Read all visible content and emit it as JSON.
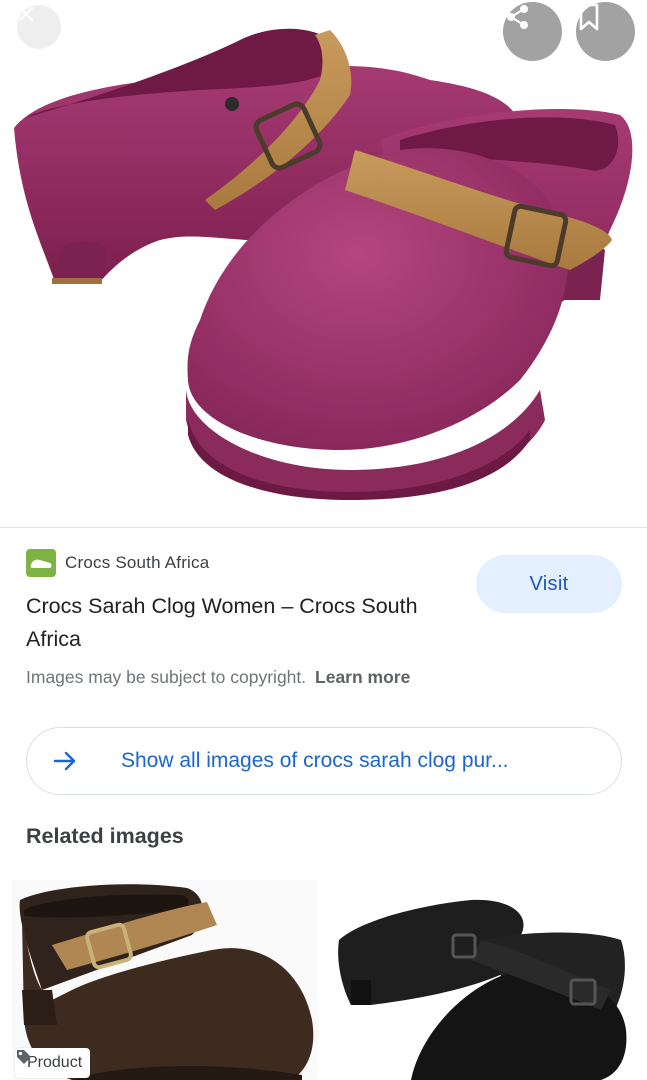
{
  "viewer": {
    "close_icon": "close-icon",
    "share_icon": "share-icon",
    "save_icon": "bookmark-icon",
    "image_subject": "crocs-sarah-clog-plum"
  },
  "result": {
    "source_name": "Crocs South Africa",
    "favicon_icon": "shoe-icon",
    "favicon_color": "#7cb342",
    "title": "Crocs Sarah Clog Women – Crocs South Africa",
    "visit_label": "Visit",
    "copyright_text": "Images may be subject to copyright.",
    "learn_more_label": "Learn more"
  },
  "show_all": {
    "icon": "arrow-right-icon",
    "label": "Show all images of crocs sarah clog pur..."
  },
  "related": {
    "heading": "Related images",
    "items": [
      {
        "badge_label": "Product",
        "badge_icon": "tag-icon",
        "subject": "brown-clog"
      },
      {
        "subject": "black-clog"
      }
    ]
  },
  "colors": {
    "accent": "#1a66d0",
    "visit_bg": "#e4efff",
    "clog_plum": "#9b2f66",
    "strap_tan": "#b98a4e"
  }
}
